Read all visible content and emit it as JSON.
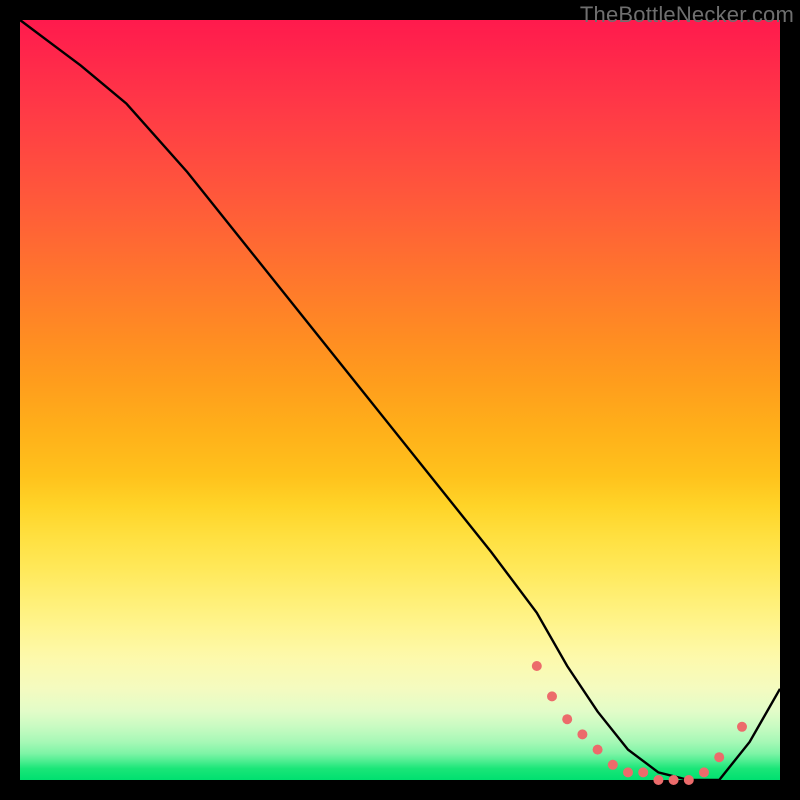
{
  "watermark": "TheBottleNecker.com",
  "colors": {
    "top": "#ff1a4d",
    "mid": "#ffd428",
    "bottom": "#00e070",
    "curve": "#000000",
    "marker": "#ec6b6b"
  },
  "chart_data": {
    "type": "line",
    "title": "",
    "xlabel": "",
    "ylabel": "",
    "xlim": [
      0,
      100
    ],
    "ylim": [
      0,
      100
    ],
    "x": [
      0,
      4,
      8,
      14,
      22,
      30,
      38,
      46,
      54,
      62,
      68,
      72,
      76,
      80,
      84,
      88,
      92,
      96,
      100
    ],
    "values": [
      100,
      97,
      94,
      89,
      80,
      70,
      60,
      50,
      40,
      30,
      22,
      15,
      9,
      4,
      1,
      0,
      0,
      5,
      12
    ],
    "series": [
      {
        "name": "curve",
        "x": [
          0,
          4,
          8,
          14,
          22,
          30,
          38,
          46,
          54,
          62,
          68,
          72,
          76,
          80,
          84,
          88,
          92,
          96,
          100
        ],
        "values": [
          100,
          97,
          94,
          89,
          80,
          70,
          60,
          50,
          40,
          30,
          22,
          15,
          9,
          4,
          1,
          0,
          0,
          5,
          12
        ]
      },
      {
        "name": "markers",
        "x": [
          68,
          70,
          72,
          74,
          76,
          78,
          80,
          82,
          84,
          86,
          88,
          90,
          92,
          95
        ],
        "values": [
          15,
          11,
          8,
          6,
          4,
          2,
          1,
          1,
          0,
          0,
          0,
          1,
          3,
          7
        ]
      }
    ]
  }
}
